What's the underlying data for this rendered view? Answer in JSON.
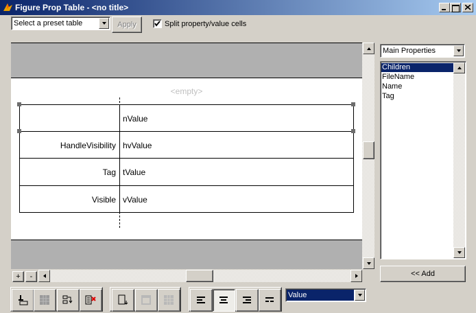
{
  "window": {
    "title": "Figure Prop Table - <no title>"
  },
  "toolbar": {
    "preset_select": "Select a preset table",
    "apply_label": "Apply",
    "split_label": "Split property/value cells",
    "split_checked": true
  },
  "canvas": {
    "empty_label": "<empty>",
    "rows": [
      {
        "property": "",
        "value": "nValue"
      },
      {
        "property": "HandleVisibility",
        "value": "hvValue"
      },
      {
        "property": "Tag",
        "value": "tValue"
      },
      {
        "property": "Visible",
        "value": "vValue"
      }
    ]
  },
  "right_panel": {
    "group_select": "Main Properties",
    "properties": [
      "Children",
      "FileName",
      "Name",
      "Tag"
    ],
    "selected_index": 0,
    "add_label": "<< Add"
  },
  "zoom": {
    "plus": "+",
    "minus": "-"
  },
  "bottom": {
    "column_select": "Value"
  },
  "colors": {
    "selection": "#0a246a",
    "titlebar": "#0a246a"
  }
}
